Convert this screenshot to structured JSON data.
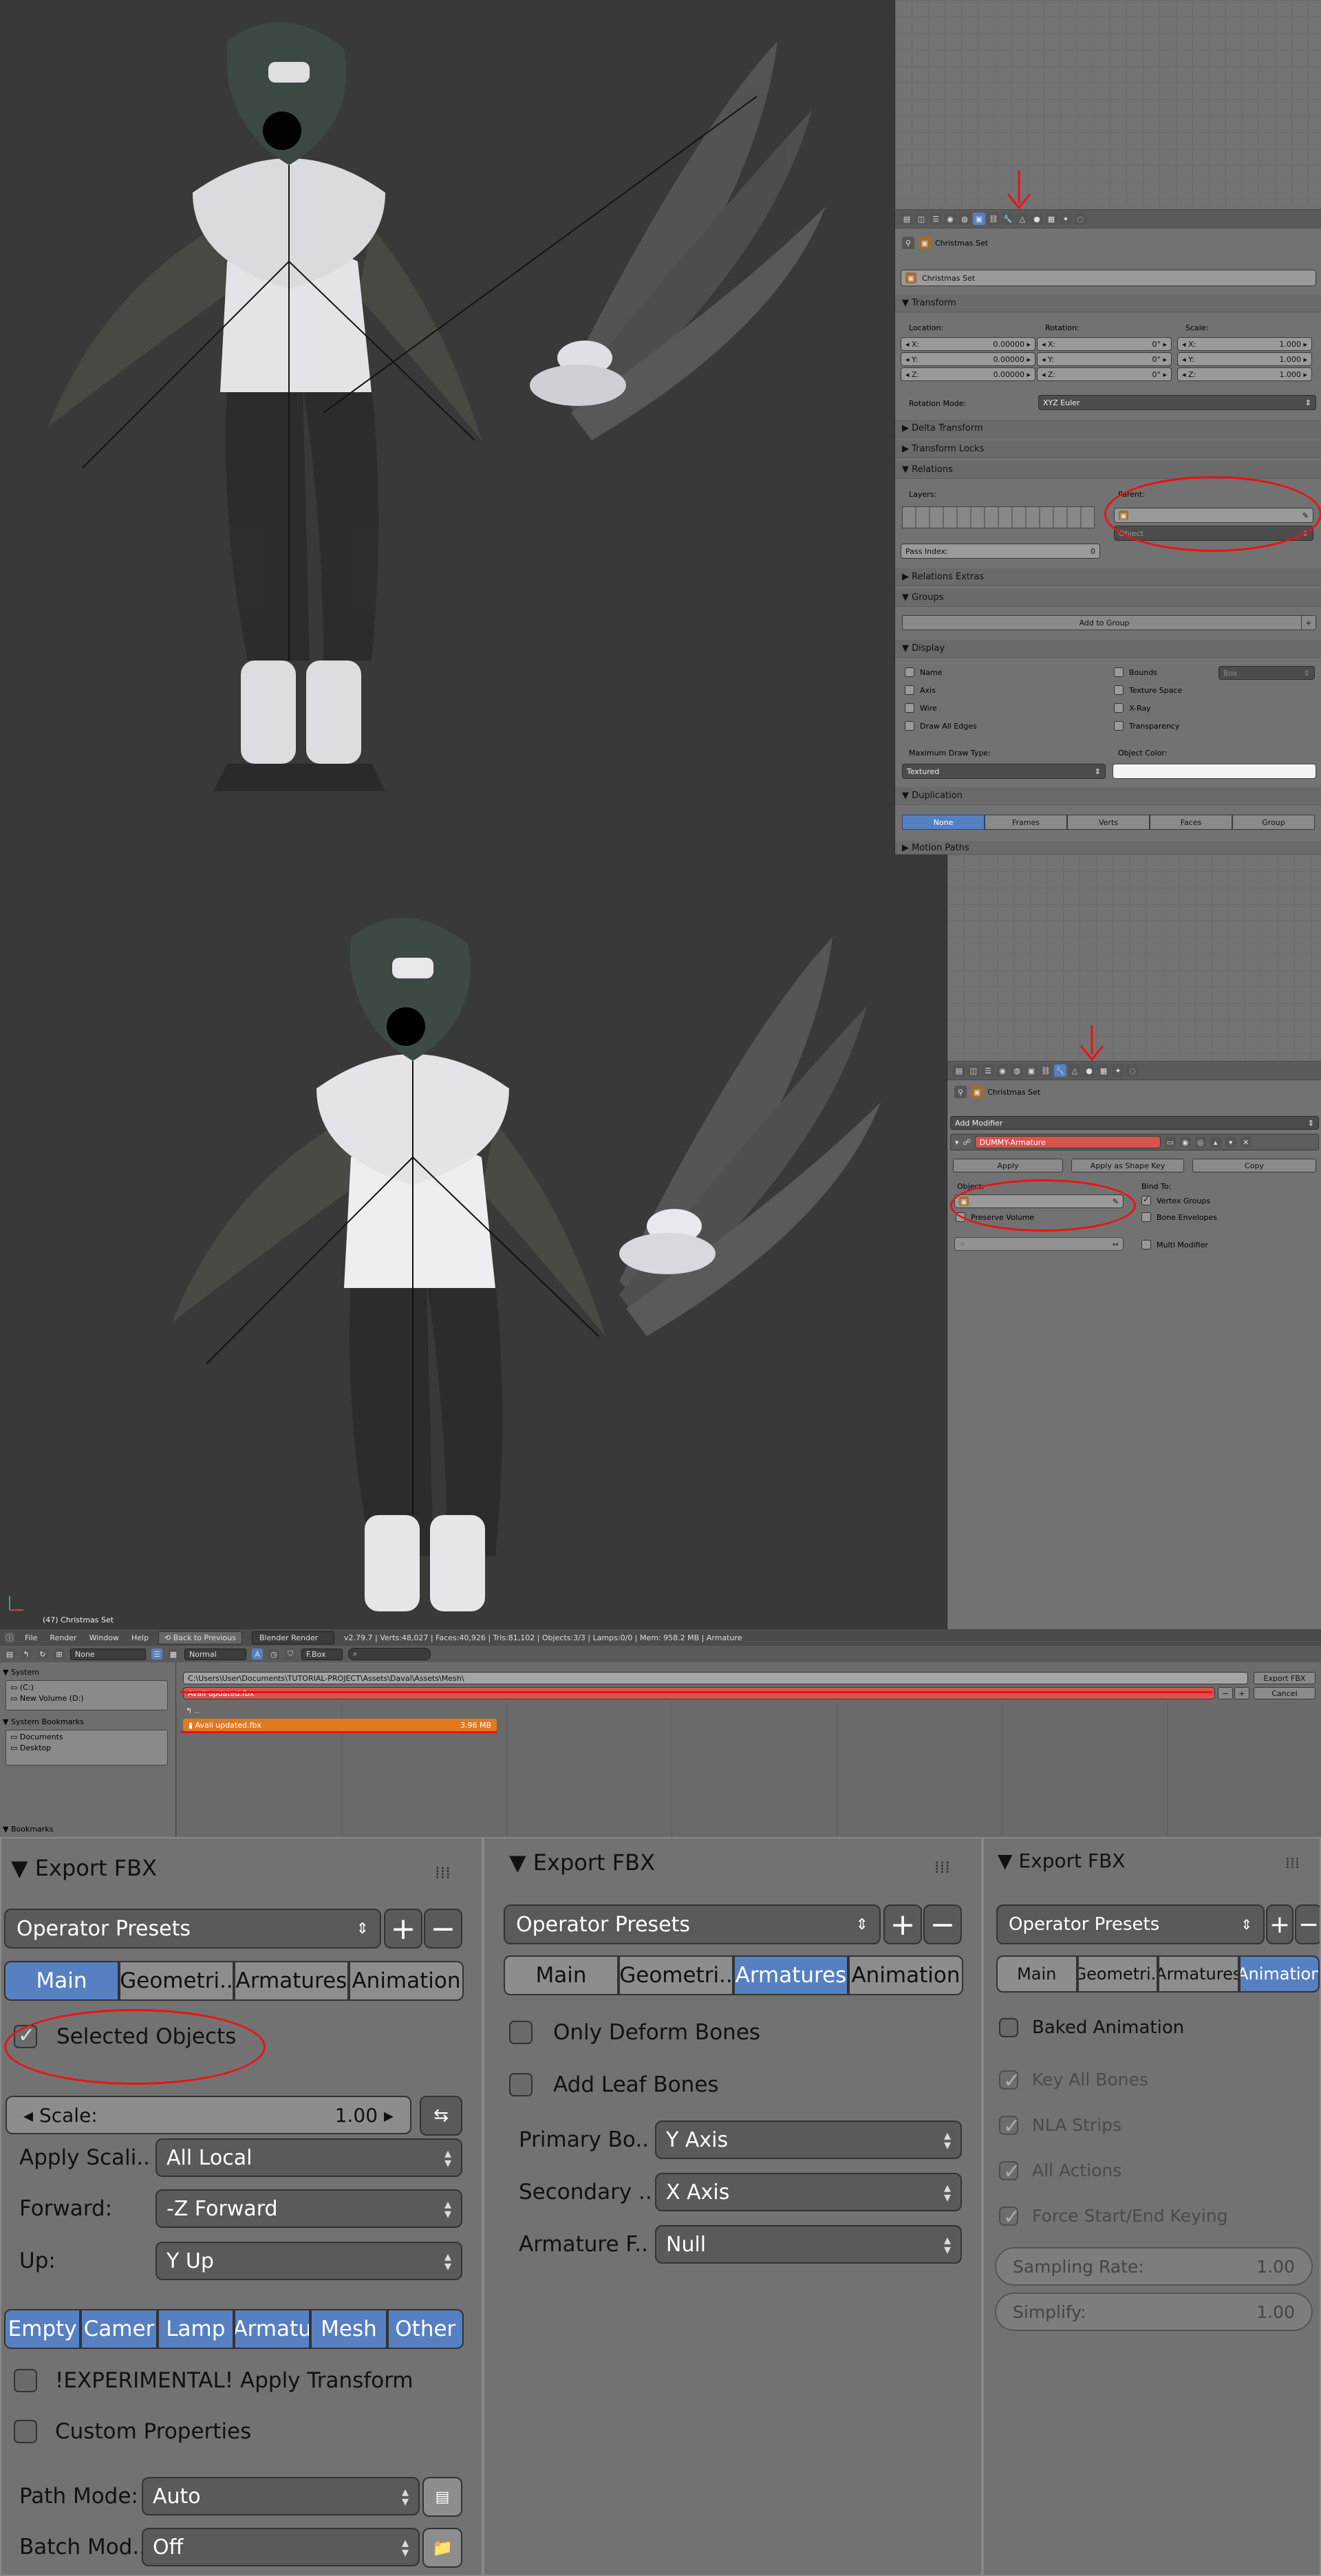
{
  "top_view": {
    "props_context": "Christmas Set",
    "name_field": "Christmas Set",
    "sections": {
      "transform": "Transform",
      "delta": "Delta Transform",
      "locks": "Transform Locks",
      "relations": "Relations",
      "relations_extras": "Relations Extras",
      "groups": "Groups",
      "display": "Display",
      "duplication": "Duplication",
      "motion": "Motion Paths"
    },
    "labels": {
      "location": "Location:",
      "rotation": "Rotation:",
      "scale": "Scale:",
      "rotation_mode": "Rotation Mode:",
      "layers": "Layers:",
      "parent": "Parent:",
      "pass_index": "Pass Index:",
      "max_draw": "Maximum Draw Type:",
      "object_color": "Object Color:"
    },
    "location": [
      {
        "axis": "X:",
        "value": "0.00000"
      },
      {
        "axis": "Y:",
        "value": "0.00000"
      },
      {
        "axis": "Z:",
        "value": "0.00000"
      }
    ],
    "rotation": [
      {
        "axis": "X:",
        "value": "0°"
      },
      {
        "axis": "Y:",
        "value": "0°"
      },
      {
        "axis": "Z:",
        "value": "0°"
      }
    ],
    "scale": [
      {
        "axis": "X:",
        "value": "1.000"
      },
      {
        "axis": "Y:",
        "value": "1.000"
      },
      {
        "axis": "Z:",
        "value": "1.000"
      }
    ],
    "rotation_mode": "XYZ Euler",
    "parent_type": "Object",
    "pass_index": "0",
    "add_to_group": "Add to Group",
    "display_left": [
      "Name",
      "Axis",
      "Wire",
      "Draw All Edges"
    ],
    "display_right": [
      "Bounds",
      "Texture Space",
      "X-Ray",
      "Transparency"
    ],
    "bounds_type": "Box",
    "max_draw_value": "Textured",
    "duplication": [
      "None",
      "Frames",
      "Verts",
      "Faces",
      "Group"
    ],
    "duplication_active": "None"
  },
  "mid_view": {
    "props_context": "Christmas Set",
    "add_modifier": "Add Modifier",
    "modifier_name": "DUMMY-Armature",
    "buttons": {
      "apply": "Apply",
      "apply_shape": "Apply as Shape Key",
      "copy": "Copy"
    },
    "object_label": "Object:",
    "bind_to": "Bind To:",
    "preserve_volume": "Preserve Volume",
    "bind_options": [
      {
        "label": "Vertex Groups",
        "checked": true
      },
      {
        "label": "Bone Envelopes",
        "checked": false
      }
    ],
    "multi_modifier": "Multi Modifier",
    "viewport_label": "(47) Christmas Set"
  },
  "file_browser": {
    "menus": [
      "File",
      "Render",
      "Window",
      "Help"
    ],
    "back": "Back to Previous",
    "engine": "Blender Render",
    "stats": "v2.79.7 | Verts:48,027 | Faces:40,926 | Tris:81,102 | Objects:3/3 | Lamps:0/0 | Mem: 958.2 MB | Armature",
    "display_mode": "None",
    "sort_mode": "Normal",
    "filter": "F.Box",
    "path": "C:\\Users\\User\\Documents\\TUTORIAL-PROJECT\\Assets\\Daval\\Assets\\Mesh\\",
    "filename": "Avali updated.fbx",
    "export_button": "Export FBX",
    "cancel_button": "Cancel",
    "parent_dir": "..",
    "file_item": {
      "name": "Avali updated.fbx",
      "size": "3.96 MB"
    },
    "sidebar": {
      "system": "System",
      "drives": [
        "(C:)",
        "New Volume (D:)"
      ],
      "bookmarks_title": "System Bookmarks",
      "bookmarks": [
        "Documents",
        "Desktop"
      ],
      "bookmarks2": "Bookmarks"
    }
  },
  "export_main": {
    "title": "Export FBX",
    "presets": "Operator Presets",
    "tabs": [
      "Main",
      "Geometri..",
      "Armatures",
      "Animation"
    ],
    "active_tab": "Main",
    "selected_objects": "Selected Objects",
    "scale_label": "Scale:",
    "scale_value": "1.00",
    "apply_scaling_label": "Apply Scali..",
    "apply_scaling_value": "All Local",
    "forward_label": "Forward:",
    "forward_value": "-Z Forward",
    "up_label": "Up:",
    "up_value": "Y Up",
    "types": [
      "Empty",
      "Camer",
      "Lamp",
      "Armatu",
      "Mesh",
      "Other"
    ],
    "apply_transform": "!EXPERIMENTAL! Apply Transform",
    "custom_props": "Custom Properties",
    "path_mode_label": "Path Mode:",
    "path_mode_value": "Auto",
    "batch_label": "Batch Mod..",
    "batch_value": "Off"
  },
  "export_arm": {
    "title": "Export FBX",
    "presets": "Operator Presets",
    "tabs": [
      "Main",
      "Geometri..",
      "Armatures",
      "Animation"
    ],
    "active_tab": "Armatures",
    "only_deform": "Only Deform Bones",
    "leaf_bones": "Add Leaf Bones",
    "primary_label": "Primary Bo..",
    "primary_value": "Y Axis",
    "secondary_label": "Secondary ..",
    "secondary_value": "X Axis",
    "armature_label": "Armature F..",
    "armature_value": "Null"
  },
  "export_anim": {
    "title": "Export FBX",
    "presets": "Operator Presets",
    "tabs": [
      "Main",
      "Geometri..",
      "Armatures",
      "Animation"
    ],
    "active_tab": "Animation",
    "baked": "Baked Animation",
    "options": [
      "Key All Bones",
      "NLA Strips",
      "All Actions",
      "Force Start/End Keying"
    ],
    "sampling_label": "Sampling Rate:",
    "sampling_value": "1.00",
    "simplify_label": "Simplify:",
    "simplify_value": "1.00"
  },
  "colors": {
    "accent_blue": "#5680c2",
    "annotation_red": "#e11111",
    "file_highlight": "#e07a1f",
    "error_red": "#d9534f"
  }
}
